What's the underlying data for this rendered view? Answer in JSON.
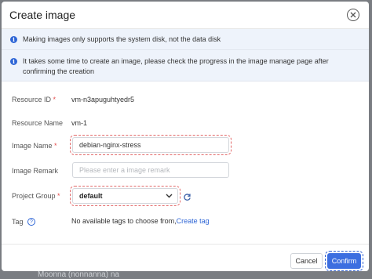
{
  "dialog": {
    "title": "Create image",
    "close_icon": "close-circle-icon"
  },
  "notices": [
    {
      "text": "Making images only supports the system disk, not the data disk"
    },
    {
      "text": "It takes some time to create an image, please check the progress in the image manage page after confirming the creation"
    }
  ],
  "form": {
    "resource_id": {
      "label": "Resource ID",
      "required": "*",
      "value": "vm-n3apuguhtyedr5"
    },
    "resource_name": {
      "label": "Resource Name",
      "value": "vm-1"
    },
    "image_name": {
      "label": "Image Name",
      "required": "*",
      "value": "debian-nginx-stress"
    },
    "image_remark": {
      "label": "Image Remark",
      "placeholder": "Please enter a image remark"
    },
    "project_group": {
      "label": "Project Group",
      "required": "*",
      "value": "default"
    },
    "tag": {
      "label": "Tag",
      "text": "No available tags to choose from,",
      "link": "Create tag"
    }
  },
  "footer": {
    "cancel_label": "Cancel",
    "confirm_label": "Confirm"
  },
  "background_text": "Moonna (nonnanna) na"
}
